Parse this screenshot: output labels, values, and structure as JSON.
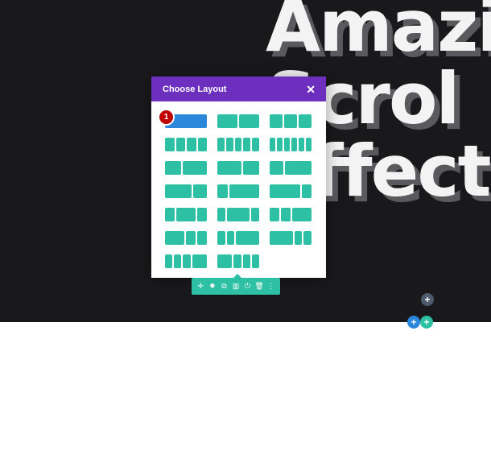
{
  "headline": {
    "lines": [
      "Amazi",
      "Scrol",
      "Effect"
    ]
  },
  "modal": {
    "title": "Choose Layout",
    "close_symbol": "✕",
    "badge": "1",
    "layouts": [
      {
        "name": "1 column",
        "cols": [
          1
        ],
        "selected": true
      },
      {
        "name": "1/2 + 1/2",
        "cols": [
          1,
          1
        ]
      },
      {
        "name": "1/3 + 1/3 + 1/3",
        "cols": [
          1,
          1,
          1
        ]
      },
      {
        "name": "1/4 x 4",
        "cols": [
          1,
          1,
          1,
          1
        ]
      },
      {
        "name": "1/5 x 5",
        "cols": [
          1,
          1,
          1,
          1,
          1
        ]
      },
      {
        "name": "1/6 x 6",
        "cols": [
          1,
          1,
          1,
          1,
          1,
          1
        ]
      },
      {
        "name": "2/5 + 3/5",
        "cols": [
          2,
          3
        ]
      },
      {
        "name": "3/5 + 2/5",
        "cols": [
          3,
          2
        ]
      },
      {
        "name": "1/3 + 2/3",
        "cols": [
          1,
          2
        ]
      },
      {
        "name": "2/3 + 1/3",
        "cols": [
          2,
          1
        ]
      },
      {
        "name": "1/4 + 3/4",
        "cols": [
          1,
          3
        ]
      },
      {
        "name": "3/4 + 1/4",
        "cols": [
          3,
          1
        ]
      },
      {
        "name": "1/4 + 1/2 + 1/4",
        "cols": [
          1,
          2,
          1
        ]
      },
      {
        "name": "1/5 + 3/5 + 1/5",
        "cols": [
          1,
          3,
          1
        ]
      },
      {
        "name": "1/4 + 1/4 + 1/2",
        "cols": [
          1,
          1,
          2
        ]
      },
      {
        "name": "1/2 + 1/4 + 1/4",
        "cols": [
          2,
          1,
          1
        ]
      },
      {
        "name": "1/5 + 1/5 + 3/5",
        "cols": [
          1,
          1,
          3
        ]
      },
      {
        "name": "3/5 + 1/5 + 1/5",
        "cols": [
          3,
          1,
          1
        ]
      },
      {
        "name": "1/6 x 4 + 1/3",
        "cols": [
          1,
          1,
          1,
          2
        ]
      },
      {
        "name": "1/3 + 1/6 x 4",
        "cols": [
          2,
          1,
          1,
          1
        ]
      }
    ]
  },
  "toolbar": {
    "icons": [
      "move-icon",
      "gear-icon",
      "duplicate-icon",
      "columns-icon",
      "power-icon",
      "trash-icon",
      "more-icon"
    ],
    "glyphs": [
      "✛",
      "✹",
      "⧉",
      "▥",
      "⏻",
      "🗑",
      "⋮"
    ]
  },
  "add_buttons": {
    "gray": "+",
    "blue": "+",
    "teal": "+"
  },
  "colors": {
    "accent_purple": "#6d2fbd",
    "teal": "#2ec0a4",
    "blue": "#2b87da",
    "badge_red": "#c00000",
    "dark_bg": "#19191b"
  }
}
